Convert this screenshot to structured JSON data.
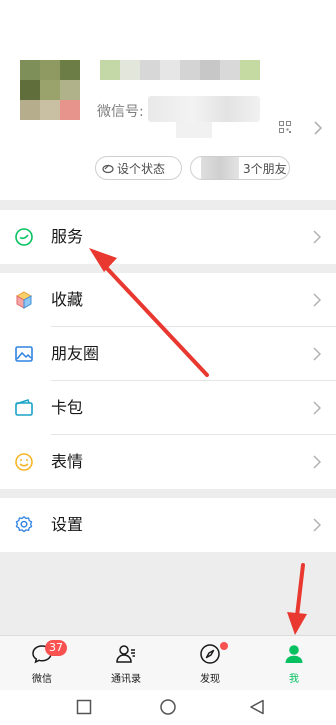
{
  "profile": {
    "wechat_id_label": "微信号: ",
    "status_button": "设个状态",
    "friends_button": "3个朋友"
  },
  "menu": {
    "service": "服务",
    "favorites": "收藏",
    "moments": "朋友圈",
    "cards": "卡包",
    "stickers": "表情",
    "settings": "设置"
  },
  "tabbar": {
    "chats": "微信",
    "chats_badge": "37",
    "contacts": "通讯录",
    "discover": "发现",
    "me": "我"
  },
  "colors": {
    "accent": "#07c160",
    "badge": "#fa5151",
    "annotation_arrow": "#e8382f"
  }
}
